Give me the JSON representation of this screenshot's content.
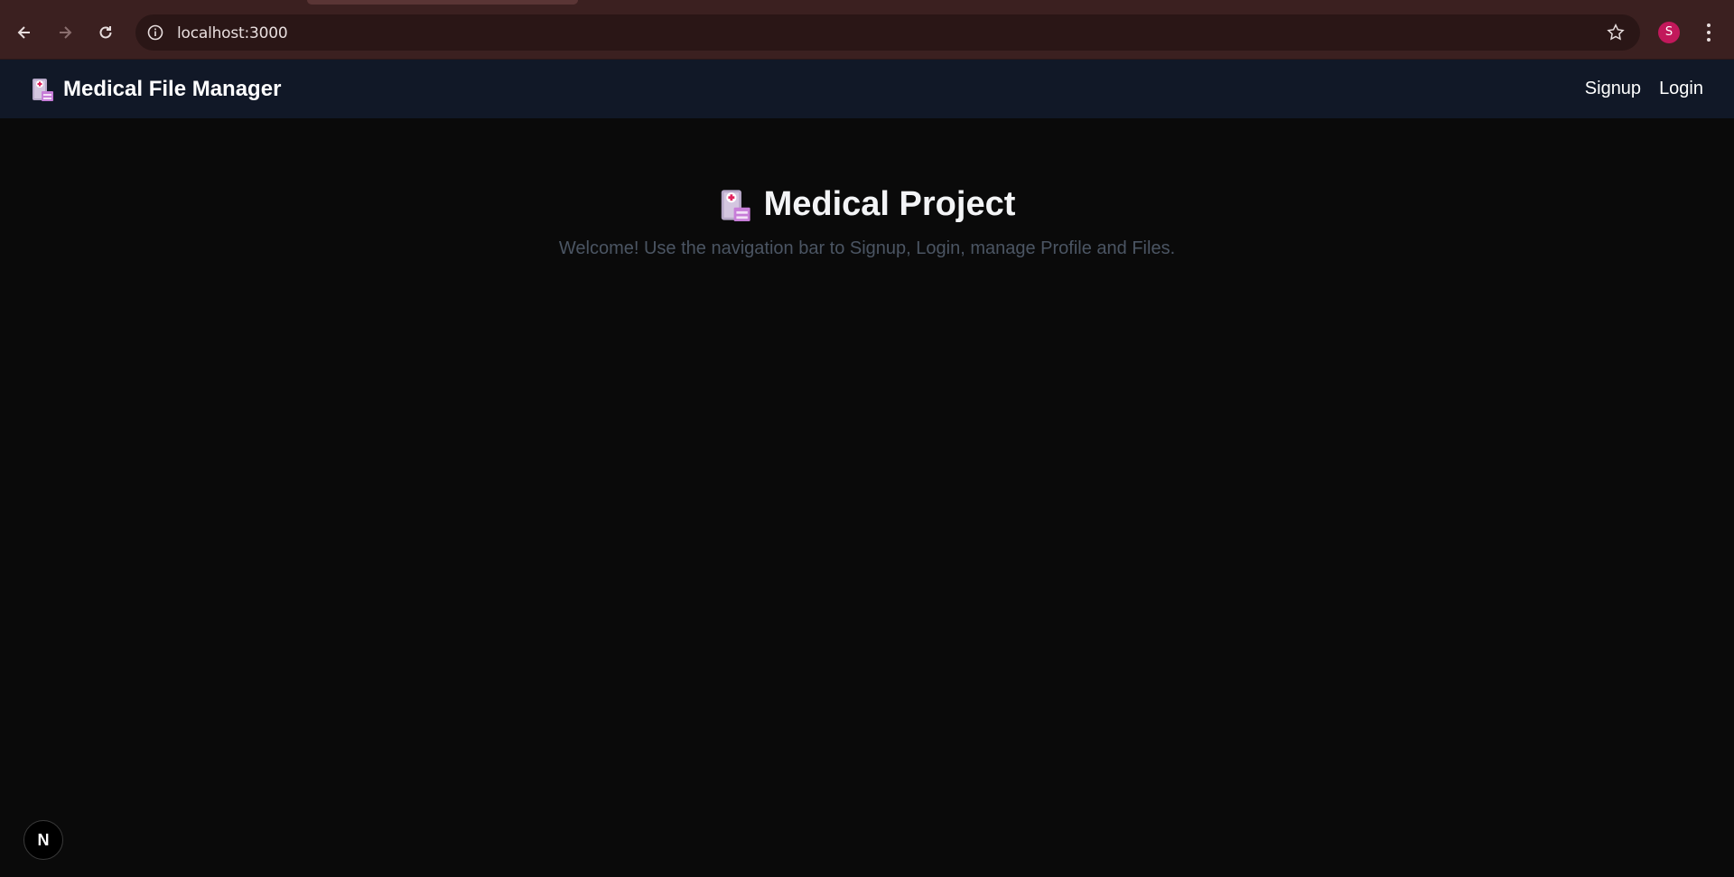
{
  "browser": {
    "url": "localhost:3000",
    "profile_initial": "S",
    "colors": {
      "toolbar": "#3b2020",
      "omnibox": "#2a1616",
      "avatar": "#c2185b"
    },
    "icons": [
      "back-icon",
      "forward-icon",
      "reload-icon",
      "info-icon",
      "star-icon",
      "menu-icon"
    ]
  },
  "navbar": {
    "brand": "Medical File Manager",
    "brand_icon": "hospital-icon",
    "links": [
      {
        "label": "Signup"
      },
      {
        "label": "Login"
      }
    ],
    "background": "#111827"
  },
  "main": {
    "title": "Medical Project",
    "title_icon": "hospital-icon",
    "subtitle": "Welcome! Use the navigation bar to Signup, Login, manage Profile and Files."
  },
  "dev_badge": {
    "label": "N",
    "icon": "nextjs-icon"
  }
}
